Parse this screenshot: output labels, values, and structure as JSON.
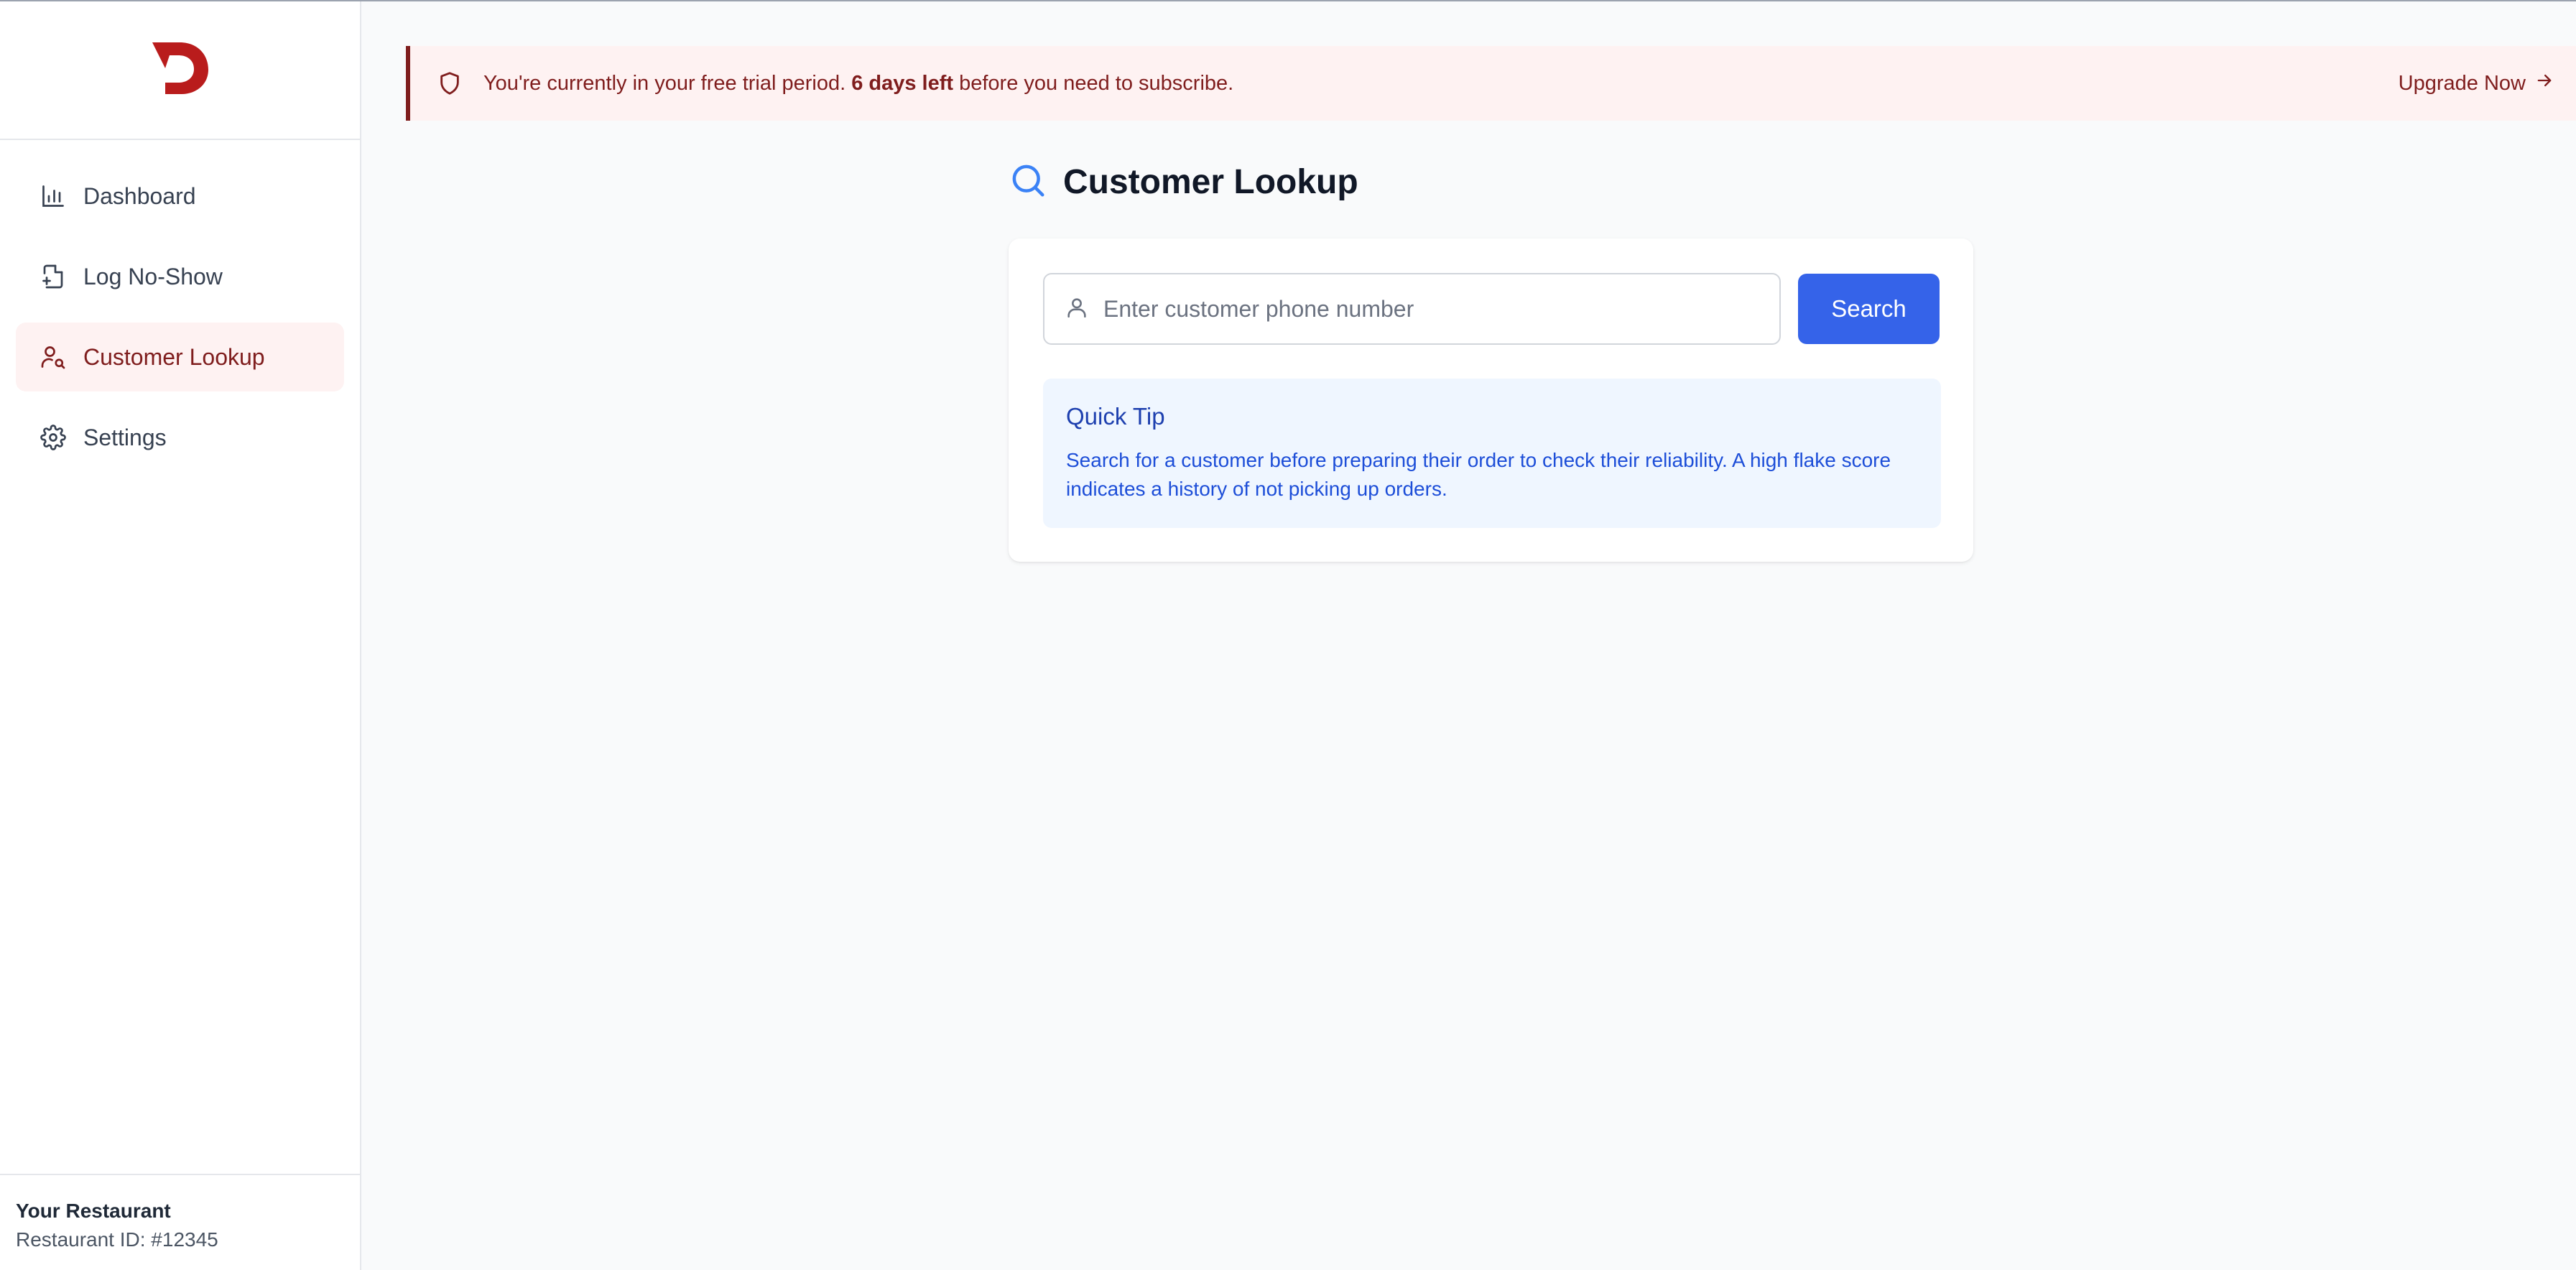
{
  "colors": {
    "brand": "#b91c1c",
    "banner_bg": "#fef2f2",
    "banner_text": "#7f1d1d",
    "primary_button": "#3563e9",
    "tip_bg": "#eff6ff",
    "tip_text": "#1d4ed8",
    "search_icon": "#3b82f6"
  },
  "sidebar": {
    "logo_icon": "d-logo-icon",
    "items": [
      {
        "label": "Dashboard",
        "icon": "bar-chart-icon",
        "active": false
      },
      {
        "label": "Log No-Show",
        "icon": "file-plus-icon",
        "active": false
      },
      {
        "label": "Customer Lookup",
        "icon": "user-search-icon",
        "active": true
      },
      {
        "label": "Settings",
        "icon": "gear-icon",
        "active": false
      }
    ],
    "footer": {
      "restaurant_name": "Your Restaurant",
      "restaurant_id": "Restaurant ID: #12345"
    }
  },
  "banner": {
    "icon": "shield-icon",
    "text_before": "You're currently in your free trial period. ",
    "text_bold": "6 days left",
    "text_after": " before you need to subscribe.",
    "upgrade_label": "Upgrade Now",
    "upgrade_icon": "arrow-right-icon"
  },
  "main": {
    "title": "Customer Lookup",
    "title_icon": "search-icon",
    "search": {
      "placeholder": "Enter customer phone number",
      "value": "",
      "input_icon": "user-icon",
      "button_label": "Search"
    },
    "tip": {
      "title": "Quick Tip",
      "body": "Search for a customer before preparing their order to check their reliability. A high flake score indicates a history of not picking up orders."
    }
  }
}
